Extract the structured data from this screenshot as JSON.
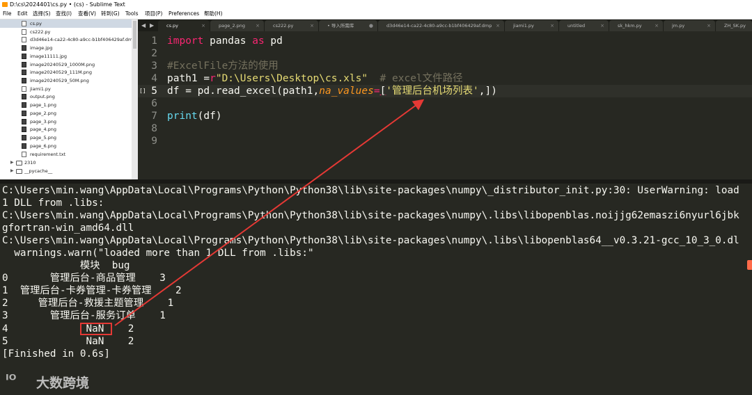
{
  "window": {
    "title": "D:\\cs\\2024401\\cs.py • (cs) - Sublime Text"
  },
  "menu": [
    "File",
    "Edit",
    "选择(S)",
    "查找(I)",
    "查看(V)",
    "转到(G)",
    "Tools",
    "项目(P)",
    "Preferences",
    "帮助(H)"
  ],
  "sidebar": {
    "files": [
      {
        "name": "cs.py",
        "type": "file",
        "selected": true
      },
      {
        "name": "cs222.py",
        "type": "file"
      },
      {
        "name": "d3d46e14-ca22-4c80-a9cc-b1bf406429af.dmp",
        "type": "file"
      },
      {
        "name": "image.jpg",
        "type": "image"
      },
      {
        "name": "image11111.jpg",
        "type": "image"
      },
      {
        "name": "image20240529_1000M.png",
        "type": "image"
      },
      {
        "name": "image20240529_111M.png",
        "type": "image"
      },
      {
        "name": "image20240529_50M.png",
        "type": "image"
      },
      {
        "name": "jiami1.py",
        "type": "file"
      },
      {
        "name": "output.png",
        "type": "image"
      },
      {
        "name": "page_1.png",
        "type": "image"
      },
      {
        "name": "page_2.png",
        "type": "image"
      },
      {
        "name": "page_3.png",
        "type": "image"
      },
      {
        "name": "page_4.png",
        "type": "image"
      },
      {
        "name": "page_5.png",
        "type": "image"
      },
      {
        "name": "page_6.png",
        "type": "image"
      },
      {
        "name": "requirement.txt",
        "type": "file"
      }
    ],
    "folders": [
      "2310",
      "__pycache__"
    ]
  },
  "tabs": [
    {
      "label": "cs.py",
      "active": true
    },
    {
      "label": "page_2.png"
    },
    {
      "label": "cs222.py"
    },
    {
      "label": "• 导入所需库"
    },
    {
      "label": "d3d46e14-ca22-4c80-a9cc-b1bf406429af.dmp"
    },
    {
      "label": "jiami1.py"
    },
    {
      "label": "untitled"
    },
    {
      "label": "sk_hkm.py"
    },
    {
      "label": "jm.py"
    },
    {
      "label": "ZH_SK.py"
    }
  ],
  "editor": {
    "line_numbers": [
      "1",
      "2",
      "3",
      "4",
      "5",
      "6",
      "7",
      "8",
      "9"
    ],
    "current_line": "5",
    "code": {
      "l1_import": "import",
      "l1_mod": " pandas ",
      "l1_as": "as",
      "l1_alias": " pd",
      "l3_comment": "#ExcelFile方法的使用",
      "l4_var": "path1 =",
      "l4_r": "r",
      "l4_path": "\"D:\\Users\\Desktop\\cs.xls\"",
      "l4_comment": "  # excel文件路径",
      "l5_a": "df = pd.read_excel(path1,",
      "l5_kw": "na_values",
      "l5_eq": "=",
      "l5_b": "[",
      "l5_str": "'管理后台机场列表'",
      "l5_c": ",])",
      "l7_fn": "print",
      "l7_rest": "(df)"
    }
  },
  "console": {
    "lines": [
      "C:\\Users\\min.wang\\AppData\\Local\\Programs\\Python\\Python38\\lib\\site-packages\\numpy\\_distributor_init.py:30: UserWarning: load",
      "1 DLL from .libs:",
      "C:\\Users\\min.wang\\AppData\\Local\\Programs\\Python\\Python38\\lib\\site-packages\\numpy\\.libs\\libopenblas.noijjg62emaszi6nyurl6jbk",
      "gfortran-win_amd64.dll",
      "C:\\Users\\min.wang\\AppData\\Local\\Programs\\Python\\Python38\\lib\\site-packages\\numpy\\.libs\\libopenblas64__v0.3.21-gcc_10_3_0.dl",
      "  warnings.warn(\"loaded more than 1 DLL from .libs:\"",
      "             模块  bug",
      "0       管理后台-商品管理    3",
      "1  管理后台-卡券管理-卡券管理    2",
      "2     管理后台-救援主题管理    1",
      "3       管理后台-服务订单    1",
      "4             NaN    2",
      "5             NaN    2",
      "[Finished in 0.6s]"
    ]
  },
  "watermark": {
    "logo": "ᴵᴼ",
    "text": "大数跨境"
  },
  "colors": {
    "annotation": "#e53935",
    "editor_bg": "#272822",
    "keyword": "#f92672",
    "string": "#e6db74",
    "comment": "#75715e"
  }
}
